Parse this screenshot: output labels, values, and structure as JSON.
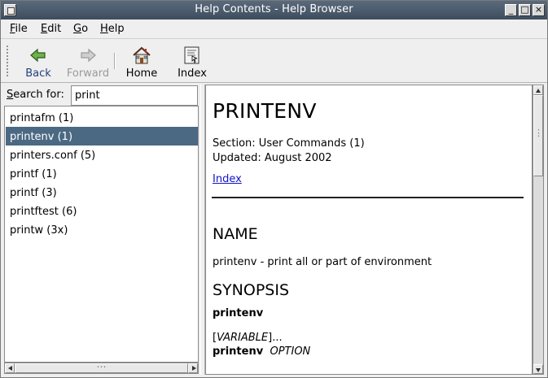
{
  "window": {
    "title": "Help Contents - Help Browser"
  },
  "menu": [
    {
      "u": "F",
      "rest": "ile"
    },
    {
      "u": "E",
      "rest": "dit"
    },
    {
      "u": "G",
      "rest": "o"
    },
    {
      "u": "H",
      "rest": "elp"
    }
  ],
  "toolbar": {
    "back_label": "Back",
    "forward_label": "Forward",
    "home_label": "Home",
    "index_label": "Index"
  },
  "search": {
    "label_u": "S",
    "label_rest": "earch for:",
    "value": "print"
  },
  "results": [
    {
      "label": "printafm (1)",
      "selected": false
    },
    {
      "label": "printenv (1)",
      "selected": true
    },
    {
      "label": "printers.conf (5)",
      "selected": false
    },
    {
      "label": "printf (1)",
      "selected": false
    },
    {
      "label": "printf (3)",
      "selected": false
    },
    {
      "label": "printftest (6)",
      "selected": false
    },
    {
      "label": "printw (3x)",
      "selected": false
    }
  ],
  "doc": {
    "title": "PRINTENV",
    "section": "Section: User Commands (1)",
    "updated": "Updated: August 2002",
    "index_link": "Index",
    "name_heading": "NAME",
    "name_text": "printenv - print all or part of environment",
    "synopsis_heading": "SYNOPSIS",
    "syn_cmd": "printenv",
    "syn_var_open": "[",
    "syn_var": "VARIABLE",
    "syn_var_close": "]...",
    "syn_cmd2": "printenv",
    "syn_option": "OPTION"
  },
  "colors": {
    "selection": "#4b6983",
    "link": "#1212c8",
    "titlebar": "#4a5a6c"
  }
}
